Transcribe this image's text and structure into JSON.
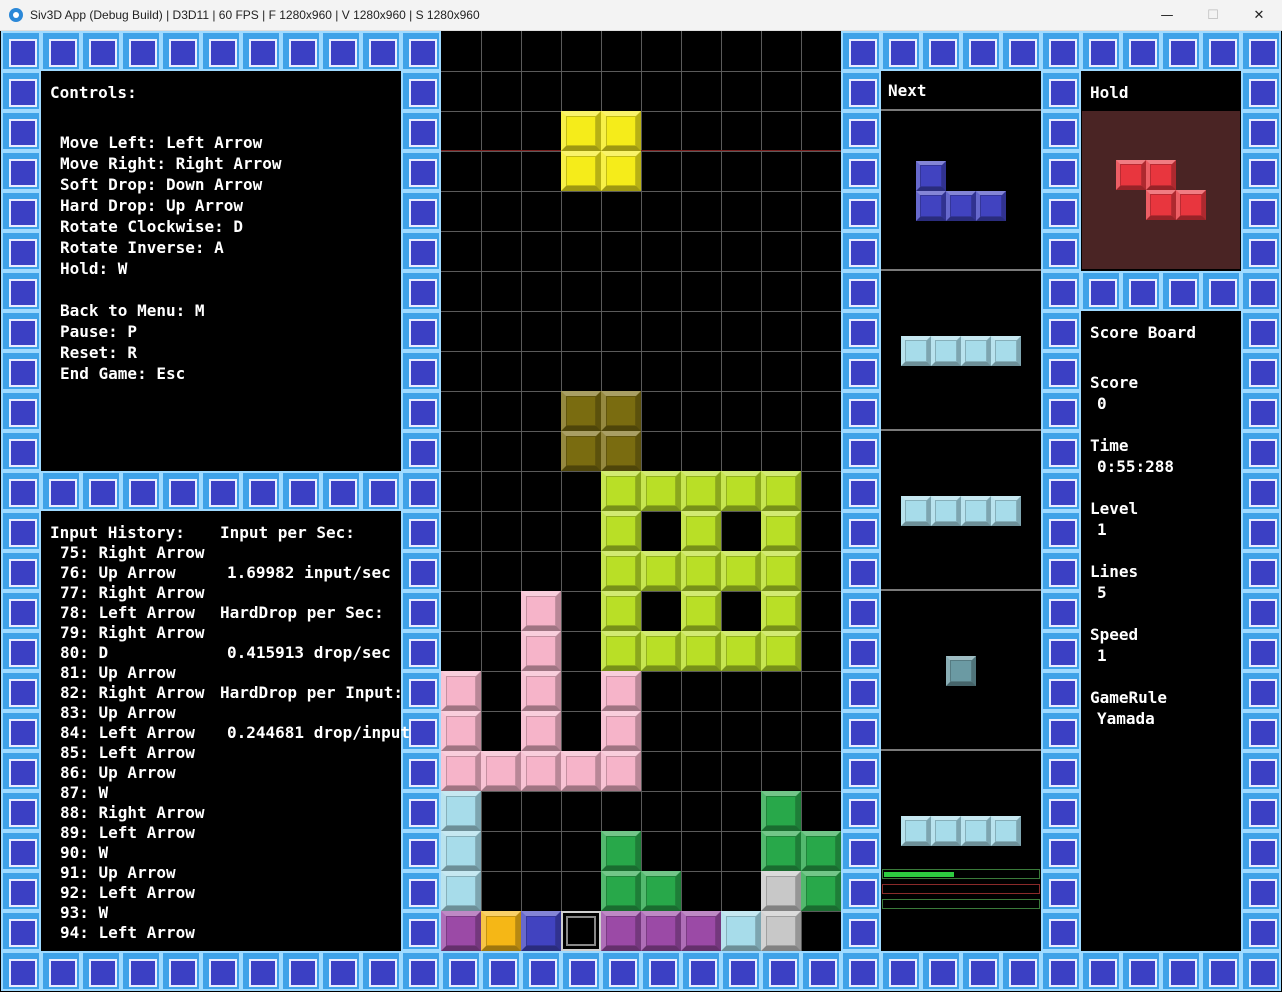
{
  "window": {
    "title": "Siv3D App (Debug Build) | D3D11 | 60 FPS | F 1280x960 | V 1280x960 | S 1280x960",
    "minimize": "—",
    "maximize": "☐",
    "close": "✕"
  },
  "controls": {
    "heading": "Controls:",
    "lines": [
      "Move Left: Left Arrow",
      "Move Right: Right Arrow",
      "Soft Drop: Down Arrow",
      "Hard Drop: Up Arrow",
      "Rotate Clockwise: D",
      "Rotate Inverse: A",
      "Hold: W"
    ],
    "lines2": [
      "Back to Menu: M",
      "Pause: P",
      "Reset: R",
      "End Game: Esc"
    ]
  },
  "history": {
    "heading": "Input History:",
    "items": [
      "75: Right Arrow",
      "76: Up Arrow",
      "77: Right Arrow",
      "78: Left Arrow",
      "79: Right Arrow",
      "80: D",
      "81: Up Arrow",
      "82: Right Arrow",
      "83: Up Arrow",
      "84: Left Arrow",
      "85: Left Arrow",
      "86: Up Arrow",
      "87: W",
      "88: Right Arrow",
      "89: Left Arrow",
      "90: W",
      "91: Up Arrow",
      "92: Left Arrow",
      "93: W",
      "94: Left Arrow"
    ]
  },
  "stats": {
    "input_label": "Input per Sec:",
    "input_value": "1.69982 input/sec",
    "harddrop_label": "HardDrop per Sec:",
    "harddrop_value": "0.415913 drop/sec",
    "hdinput_label": "HardDrop per Input:",
    "hdinput_value": "0.244681 drop/input"
  },
  "next": {
    "heading": "Next"
  },
  "hold": {
    "heading": "Hold"
  },
  "score": {
    "heading": "Score Board",
    "score_label": "Score",
    "score_value": "0",
    "time_label": "Time",
    "time_value": "0:55:288",
    "level_label": "Level",
    "level_value": "1",
    "lines_label": "Lines",
    "lines_value": "5",
    "speed_label": "Speed",
    "speed_value": "1",
    "rule_label": "GameRule",
    "rule_value": "Yamada"
  },
  "colors": {
    "yellow": "#f5ec1a",
    "ghost": "#7a6c10",
    "lime": "#b9df26",
    "pink": "#f6b4c9",
    "cyan": "#a7dcea",
    "green": "#28a84a",
    "purple": "#9b4aa6",
    "orange": "#f5b716",
    "blue": "#4143c0",
    "gray": "#c8c8c8",
    "red": "#e8363e",
    "teal": "#6b9aa3",
    "hold_bg": "#4a2424",
    "wall": "#3fa2e8"
  },
  "field": {
    "cells": [
      {
        "c": 3,
        "r": 2,
        "k": "yellow"
      },
      {
        "c": 4,
        "r": 2,
        "k": "yellow"
      },
      {
        "c": 3,
        "r": 3,
        "k": "yellow"
      },
      {
        "c": 4,
        "r": 3,
        "k": "yellow"
      },
      {
        "c": 3,
        "r": 9,
        "k": "ghost"
      },
      {
        "c": 4,
        "r": 9,
        "k": "ghost"
      },
      {
        "c": 3,
        "r": 10,
        "k": "ghost"
      },
      {
        "c": 4,
        "r": 10,
        "k": "ghost"
      },
      {
        "c": 4,
        "r": 11,
        "k": "lime"
      },
      {
        "c": 5,
        "r": 11,
        "k": "lime"
      },
      {
        "c": 6,
        "r": 11,
        "k": "lime"
      },
      {
        "c": 7,
        "r": 11,
        "k": "lime"
      },
      {
        "c": 8,
        "r": 11,
        "k": "lime"
      },
      {
        "c": 4,
        "r": 12,
        "k": "lime"
      },
      {
        "c": 6,
        "r": 12,
        "k": "lime"
      },
      {
        "c": 8,
        "r": 12,
        "k": "lime"
      },
      {
        "c": 4,
        "r": 13,
        "k": "lime"
      },
      {
        "c": 5,
        "r": 13,
        "k": "lime"
      },
      {
        "c": 6,
        "r": 13,
        "k": "lime"
      },
      {
        "c": 7,
        "r": 13,
        "k": "lime"
      },
      {
        "c": 8,
        "r": 13,
        "k": "lime"
      },
      {
        "c": 4,
        "r": 14,
        "k": "lime"
      },
      {
        "c": 6,
        "r": 14,
        "k": "lime"
      },
      {
        "c": 8,
        "r": 14,
        "k": "lime"
      },
      {
        "c": 4,
        "r": 15,
        "k": "lime"
      },
      {
        "c": 5,
        "r": 15,
        "k": "lime"
      },
      {
        "c": 6,
        "r": 15,
        "k": "lime"
      },
      {
        "c": 7,
        "r": 15,
        "k": "lime"
      },
      {
        "c": 8,
        "r": 15,
        "k": "lime"
      },
      {
        "c": 2,
        "r": 14,
        "k": "pink"
      },
      {
        "c": 2,
        "r": 15,
        "k": "pink"
      },
      {
        "c": 0,
        "r": 16,
        "k": "pink"
      },
      {
        "c": 2,
        "r": 16,
        "k": "pink"
      },
      {
        "c": 4,
        "r": 16,
        "k": "pink"
      },
      {
        "c": 0,
        "r": 17,
        "k": "pink"
      },
      {
        "c": 2,
        "r": 17,
        "k": "pink"
      },
      {
        "c": 4,
        "r": 17,
        "k": "pink"
      },
      {
        "c": 0,
        "r": 18,
        "k": "pink"
      },
      {
        "c": 1,
        "r": 18,
        "k": "pink"
      },
      {
        "c": 2,
        "r": 18,
        "k": "pink"
      },
      {
        "c": 3,
        "r": 18,
        "k": "pink"
      },
      {
        "c": 4,
        "r": 18,
        "k": "pink"
      },
      {
        "c": 0,
        "r": 19,
        "k": "cyan"
      },
      {
        "c": 0,
        "r": 20,
        "k": "cyan"
      },
      {
        "c": 0,
        "r": 21,
        "k": "cyan"
      },
      {
        "c": 4,
        "r": 20,
        "k": "green"
      },
      {
        "c": 4,
        "r": 21,
        "k": "green"
      },
      {
        "c": 5,
        "r": 21,
        "k": "green"
      },
      {
        "c": 8,
        "r": 19,
        "k": "green"
      },
      {
        "c": 8,
        "r": 20,
        "k": "green"
      },
      {
        "c": 9,
        "r": 20,
        "k": "green"
      },
      {
        "c": 9,
        "r": 21,
        "k": "green"
      },
      {
        "c": 8,
        "r": 21,
        "k": "gray"
      },
      {
        "c": 8,
        "r": 22,
        "k": "gray"
      },
      {
        "c": 0,
        "r": 22,
        "k": "purple"
      },
      {
        "c": 1,
        "r": 22,
        "k": "orange"
      },
      {
        "c": 2,
        "r": 22,
        "k": "blue"
      },
      {
        "c": 3,
        "r": 22,
        "k": "black"
      },
      {
        "c": 4,
        "r": 22,
        "k": "purple"
      },
      {
        "c": 5,
        "r": 22,
        "k": "purple"
      },
      {
        "c": 6,
        "r": 22,
        "k": "purple"
      },
      {
        "c": 7,
        "r": 22,
        "k": "cyan"
      }
    ]
  },
  "next_queue": [
    {
      "piece": "J",
      "k": "blue"
    },
    {
      "piece": "I",
      "k": "cyan"
    },
    {
      "piece": "I",
      "k": "cyan"
    },
    {
      "piece": "dot",
      "k": "teal"
    },
    {
      "piece": "I",
      "k": "cyan"
    }
  ],
  "hold_piece": {
    "piece": "Z",
    "k": "red"
  },
  "progress": {
    "bar1": 0.45,
    "bar2": 0,
    "bar3": 0
  }
}
